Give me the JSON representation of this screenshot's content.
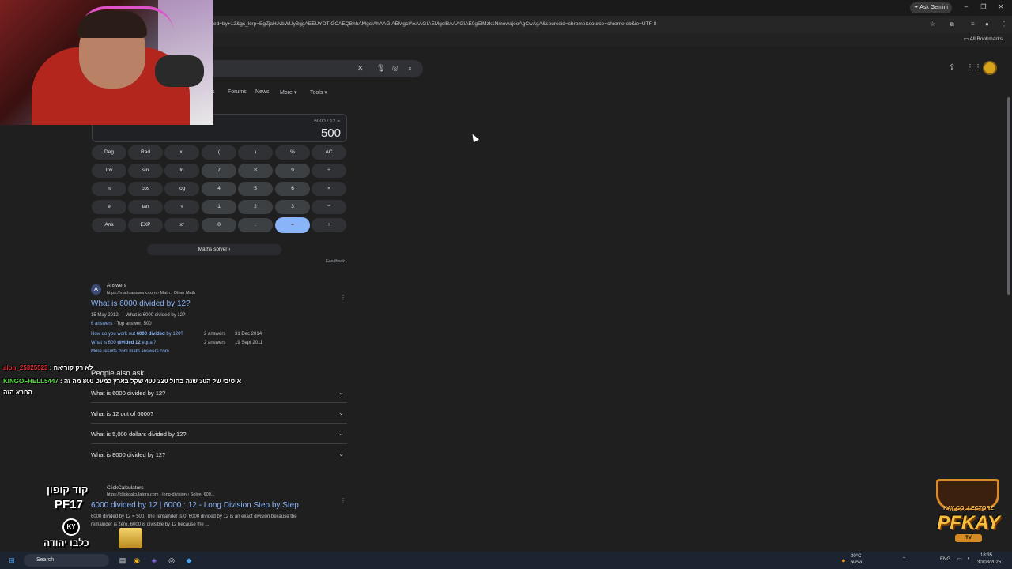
{
  "browser": {
    "ask_gemini": "Ask Gemini",
    "url": "ed+by+12&gs_lcrp=EgZjaHJvbWUyBggAEEUYOTIGCAEQBhhAMgcIAhAAGIAEMgcIAxAAGIAEMgcIBAAAGIAE0gEIMzk1NmowajeoAgCwAgA&sourceid=chrome&source=chrome.ob&ie=UTF-8",
    "all_bookmarks": "All Bookmarks"
  },
  "tabs": [
    "s",
    "Forums",
    "News",
    "More",
    "Tools"
  ],
  "calculator": {
    "expression": "6000 / 12 =",
    "result": "500",
    "rows": [
      [
        "Deg",
        "Rad",
        "x!",
        "(",
        ")",
        "%",
        "AC"
      ],
      [
        "Inv",
        "sin",
        "ln",
        "7",
        "8",
        "9",
        "÷"
      ],
      [
        "π",
        "cos",
        "log",
        "4",
        "5",
        "6",
        "×"
      ],
      [
        "e",
        "tan",
        "√",
        "1",
        "2",
        "3",
        "−"
      ],
      [
        "Ans",
        "EXP",
        "xʸ",
        "0",
        ".",
        "=",
        "+"
      ]
    ],
    "maths_solver": "Maths solver",
    "feedback": "Feedback"
  },
  "result1": {
    "site": "Answers",
    "url": "https://math.answers.com › Math › Other Math",
    "title": "What is 6000 divided by 12?",
    "meta": "15 May 2012 — What is 6000 divided by 12?",
    "answers": "6 answers",
    "top_answer": "· Top answer: 500",
    "sub": [
      {
        "q_pre": "How do you work out ",
        "q_bold": "6000 divided",
        "q_post": " by 120?",
        "count": "2 answers",
        "date": "31 Dec 2014"
      },
      {
        "q_pre": "What is 600 ",
        "q_bold": "divided 12",
        "q_post": " equal?",
        "count": "2 answers",
        "date": "19 Sept 2011"
      }
    ],
    "more": "More results from math.answers.com"
  },
  "paa": {
    "title": "People also ask",
    "questions": [
      "What is 6000 divided by 12?",
      "What is 12 out of 6000?",
      "What is 5,000 dollars divided by 12?",
      "What is 8000 divided by 12?"
    ]
  },
  "result2": {
    "site": "ClickCalculators",
    "url": "https://clickcalculators.com › long-division › Solve_600...",
    "title": "6000 divided by 12 | 6000 : 12 - Long Division Step by Step",
    "snippet1": "6000 divided by 12 = 500. The remainder is 0. 6000 divided by 12 is an exact division because the",
    "snippet2": "remainder is zero. 6000 is divisible by 12 because the ..."
  },
  "overlay": {
    "chat1_user": "alon_25325523",
    "chat1_msg": ": לא רק קוריאה",
    "chat2_user": "KINGOFHELL5447",
    "chat2_msg": ": איטיבי של ה30 שנה בחול 320 400 שקל בארץ כמעט 800 מה זה",
    "chat3": "החרא הזה",
    "promo_line1": "קוד קופון",
    "promo_line2": "PF17",
    "promo_ky": "KY",
    "promo_line3": "כלבו יהודה",
    "brand_top": "KAY COLLECTORZ",
    "brand_main": "PFKAY",
    "brand_sub": "TV"
  },
  "taskbar": {
    "search": "Search",
    "weather": "30°C",
    "weather_sub": "שמשי",
    "lang": "ENG",
    "time": "18:35",
    "date": "30/08/2026"
  },
  "colors": {
    "accent": "#8ab4f8",
    "chat_user1": "#e0303a",
    "chat_user2": "#5ee04a"
  }
}
